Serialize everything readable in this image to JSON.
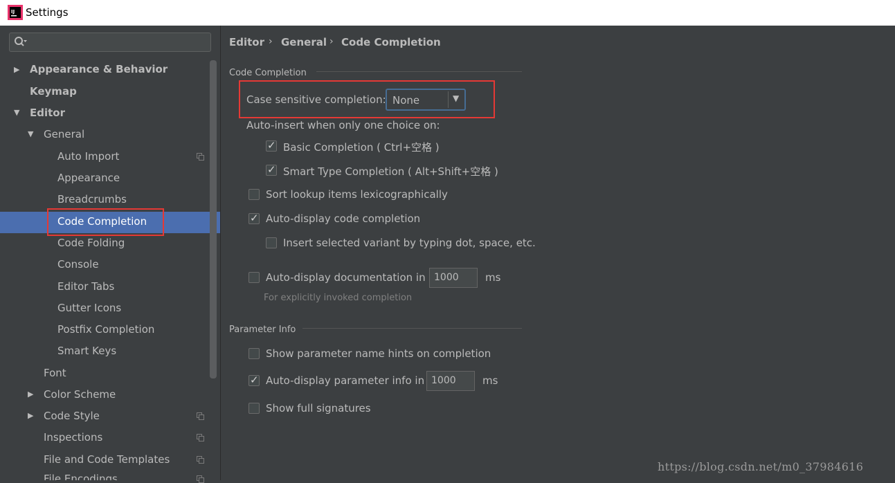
{
  "window": {
    "title": "Settings",
    "app_icon": "intellij-idea-icon"
  },
  "search": {
    "icon": "search-icon",
    "value": ""
  },
  "breadcrumb": [
    "Editor",
    "General",
    "Code Completion"
  ],
  "sidebar": {
    "items": [
      {
        "label": "Appearance & Behavior"
      },
      {
        "label": "Keymap"
      },
      {
        "label": "Editor"
      },
      {
        "label": "General"
      },
      {
        "label": "Auto Import"
      },
      {
        "label": "Appearance"
      },
      {
        "label": "Breadcrumbs"
      },
      {
        "label": "Code Completion",
        "selected": true
      },
      {
        "label": "Code Folding"
      },
      {
        "label": "Console"
      },
      {
        "label": "Editor Tabs"
      },
      {
        "label": "Gutter Icons"
      },
      {
        "label": "Postfix Completion"
      },
      {
        "label": "Smart Keys"
      },
      {
        "label": "Font"
      },
      {
        "label": "Color Scheme"
      },
      {
        "label": "Code Style"
      },
      {
        "label": "Inspections"
      },
      {
        "label": "File and Code Templates"
      },
      {
        "label": "File Encodings"
      }
    ]
  },
  "code_completion": {
    "section_title": "Code Completion",
    "case_sensitive_label": "Case sensitive completion:",
    "case_sensitive_value": "None",
    "auto_insert_label": "Auto-insert when only one choice on:",
    "basic_completion": {
      "label": "Basic Completion ( Ctrl+空格 )",
      "checked": true
    },
    "smart_type_completion": {
      "label": "Smart Type Completion ( Alt+Shift+空格 )",
      "checked": true
    },
    "sort_lookup": {
      "label": "Sort lookup items lexicographically",
      "checked": false
    },
    "auto_display_code": {
      "label": "Auto-display code completion",
      "checked": true
    },
    "insert_selected_variant": {
      "label": "Insert selected variant by typing dot, space, etc.",
      "checked": false
    },
    "auto_display_doc": {
      "label": "Auto-display documentation in",
      "checked": false,
      "value": "1000",
      "unit": "ms"
    },
    "doc_note": "For explicitly invoked completion"
  },
  "parameter_info": {
    "section_title": "Parameter Info",
    "show_hints": {
      "label": "Show parameter name hints on completion",
      "checked": false
    },
    "auto_display_param": {
      "label": "Auto-display parameter info in",
      "checked": true,
      "value": "1000",
      "unit": "ms"
    },
    "show_full_signatures": {
      "label": "Show full signatures",
      "checked": false
    }
  },
  "watermark": "https://blog.csdn.net/m0_37984616",
  "colors": {
    "selection": "#4b6eaf",
    "highlight_box": "#e53935",
    "background": "#3c3f41"
  }
}
